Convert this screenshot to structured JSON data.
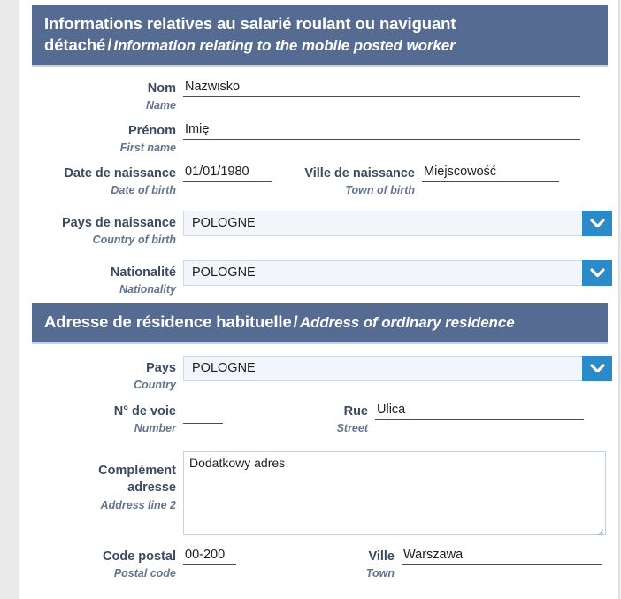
{
  "colors": {
    "header_bg": "#566b92",
    "accent_blue": "#2a8bc8",
    "label_fr": "#3b4a63",
    "label_en": "#63748f",
    "select_bg": "#f2f6fb",
    "page_bg": "#e9e9e9"
  },
  "sections": {
    "worker": {
      "title_fr": "Informations relatives au salarié roulant ou naviguant détaché",
      "separator": "/",
      "title_en": "Information relating to the mobile posted worker"
    },
    "residence": {
      "title_fr": "Adresse de résidence habituelle",
      "separator": "/",
      "title_en": "Address of ordinary residence"
    }
  },
  "fields": {
    "nom": {
      "label_fr": "Nom",
      "label_en": "Name",
      "value": "Nazwisko"
    },
    "prenom": {
      "label_fr": "Prénom",
      "label_en": "First name",
      "value": "Imię"
    },
    "date_naissance": {
      "label_fr": "Date de naissance",
      "label_en": "Date of birth",
      "value": "01/01/1980"
    },
    "ville_naissance": {
      "label_fr": "Ville de naissance",
      "label_en": "Town of birth",
      "value": "Miejscowość"
    },
    "pays_naissance": {
      "label_fr": "Pays de naissance",
      "label_en": "Country of birth",
      "value": "POLOGNE"
    },
    "nationalite": {
      "label_fr": "Nationalité",
      "label_en": "Nationality",
      "value": "POLOGNE"
    },
    "pays": {
      "label_fr": "Pays",
      "label_en": "Country",
      "value": "POLOGNE"
    },
    "numero_voie": {
      "label_fr": "N° de voie",
      "label_en": "Number",
      "value": ""
    },
    "rue": {
      "label_fr": "Rue",
      "label_en": "Street",
      "value": "Ulica"
    },
    "complement_adresse": {
      "label_fr_line1": "Complément",
      "label_fr_line2": "adresse",
      "label_en": "Address line 2",
      "value": "Dodatkowy adres"
    },
    "code_postal": {
      "label_fr": "Code postal",
      "label_en": "Postal code",
      "value": "00-200"
    },
    "ville": {
      "label_fr": "Ville",
      "label_en": "Town",
      "value": "Warszawa"
    }
  },
  "icons": {
    "dropdown": "chevron-down-icon"
  }
}
